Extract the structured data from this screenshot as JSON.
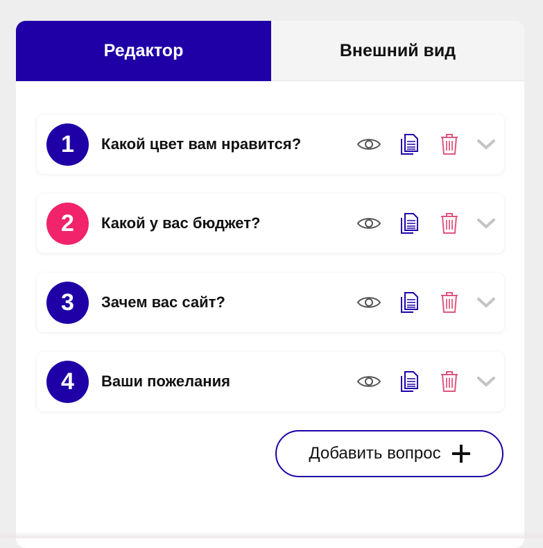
{
  "tabs": {
    "editor": "Редактор",
    "appearance": "Внешний вид"
  },
  "questions": [
    {
      "number": "1",
      "text": "Какой цвет вам нравится?",
      "badge_color": "#1e00a6"
    },
    {
      "number": "2",
      "text": "Какой у вас бюджет?",
      "badge_color": "#f0236b"
    },
    {
      "number": "3",
      "text": "Зачем вас сайт?",
      "badge_color": "#1e00a6"
    },
    {
      "number": "4",
      "text": "Ваши пожелания",
      "badge_color": "#1e00a6"
    }
  ],
  "actions": {
    "preview_icon": "eye-icon",
    "copy_icon": "copy-icon",
    "delete_icon": "trash-icon",
    "expand_icon": "chevron-down-icon"
  },
  "add_button": {
    "label": "Добавить вопрос",
    "icon": "plus-icon"
  },
  "colors": {
    "accent": "#1e00a6",
    "pink": "#f0236b",
    "delete": "#e0557d",
    "chevron": "#c4c4c4"
  }
}
